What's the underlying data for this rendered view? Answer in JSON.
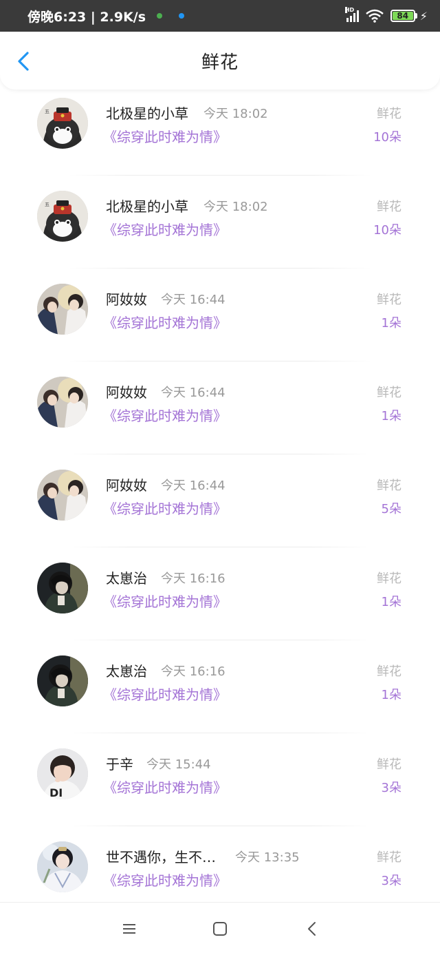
{
  "status_bar": {
    "time_speed": "傍晚6:23 | 2.9K/s",
    "network_label": "HD",
    "battery_level": "84",
    "dot_colors": [
      "#4caf50",
      "#2196f3"
    ]
  },
  "header": {
    "title": "鲜花"
  },
  "colors": {
    "accent": "#a474d6",
    "back_arrow": "#2196f3",
    "muted": "#999999"
  },
  "records": [
    {
      "name": "北极星的小草",
      "time": "今天 18:02",
      "book": "《综穿此时难为情》",
      "gift": "鲜花",
      "count": "10朵",
      "avatar": "cat-avatar"
    },
    {
      "name": "北极星的小草",
      "time": "今天 18:02",
      "book": "《综穿此时难为情》",
      "gift": "鲜花",
      "count": "10朵",
      "avatar": "cat-avatar"
    },
    {
      "name": "阿奻奻",
      "time": "今天 16:44",
      "book": "《综穿此时难为情》",
      "gift": "鲜花",
      "count": "1朵",
      "avatar": "couple-avatar"
    },
    {
      "name": "阿奻奻",
      "time": "今天 16:44",
      "book": "《综穿此时难为情》",
      "gift": "鲜花",
      "count": "1朵",
      "avatar": "couple-avatar"
    },
    {
      "name": "阿奻奻",
      "time": "今天 16:44",
      "book": "《综穿此时难为情》",
      "gift": "鲜花",
      "count": "5朵",
      "avatar": "couple-avatar"
    },
    {
      "name": "太崽治",
      "time": "今天 16:16",
      "book": "《综穿此时难为情》",
      "gift": "鲜花",
      "count": "1朵",
      "avatar": "dark-hair-avatar"
    },
    {
      "name": "太崽治",
      "time": "今天 16:16",
      "book": "《综穿此时难为情》",
      "gift": "鲜花",
      "count": "1朵",
      "avatar": "dark-hair-avatar"
    },
    {
      "name": "于辛",
      "time": "今天 15:44",
      "book": "《综穿此时难为情》",
      "gift": "鲜花",
      "count": "3朵",
      "avatar": "child-avatar"
    },
    {
      "name": "世不遇你，生不…",
      "time": "今天 13:35",
      "book": "《综穿此时难为情》",
      "gift": "鲜花",
      "count": "3朵",
      "avatar": "hanfu-avatar"
    }
  ],
  "nav_bar": {
    "icons": [
      "menu-icon",
      "home-square-icon",
      "back-triangle-icon"
    ]
  }
}
